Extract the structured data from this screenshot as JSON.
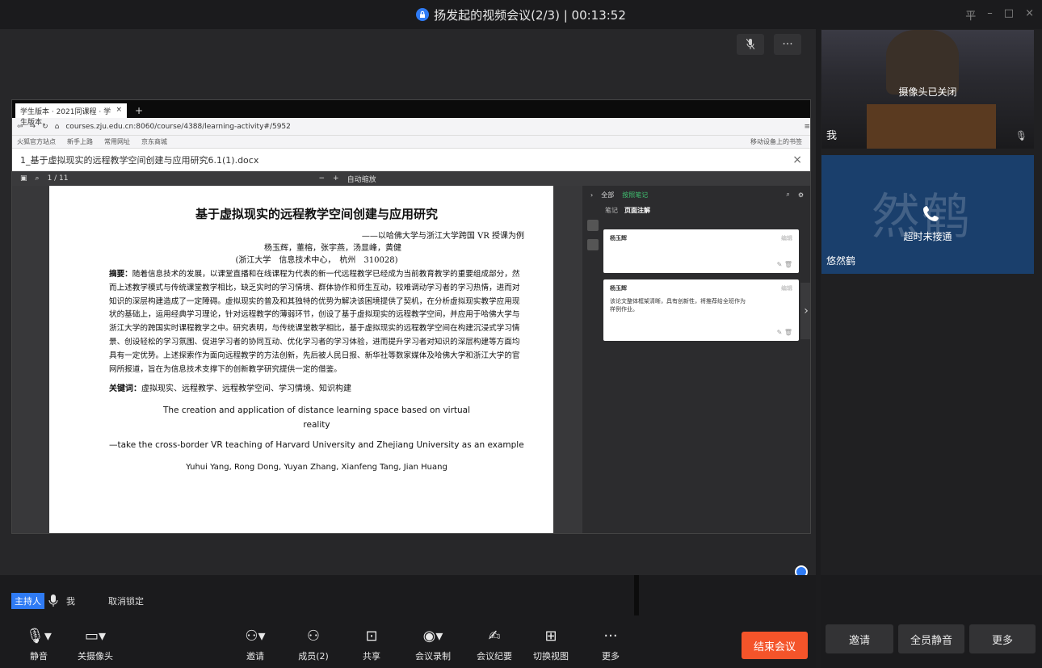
{
  "window": {
    "title": "扬发起的视频会议(2/3) | 00:13:52",
    "controls": [
      "平",
      "–",
      "□",
      "×"
    ]
  },
  "top_tools": {
    "mic_icon": "mic-icon",
    "more": "···"
  },
  "browser": {
    "tab_label": "学生版本 · 2021同课程 · 学生版本",
    "url": "courses.zju.edu.cn:8060/course/4388/learning-activity#/5952",
    "bookmarks": [
      "火狐官方站点",
      "新手上路",
      "常用网址",
      "京东商城"
    ],
    "bookmark_right": "移动设备上的书签"
  },
  "document": {
    "name": "1_基于虚拟现实的远程教学空间创建与应用研究6.1(1).docx",
    "page_indicator": "1 / 11",
    "zoom": "自动缩放"
  },
  "paper": {
    "title": "基于虚拟现实的远程教学空间创建与应用研究",
    "subtitle": "——以哈佛大学与浙江大学跨国 VR 授课为例",
    "authors": "杨玉辉，董榕，张宇燕，汤显峰，黄健",
    "affiliation": "(浙江大学　信息技术中心，　杭州　310028)",
    "abstract_label": "摘要：",
    "abstract": "随着信息技术的发展，以课堂直播和在线课程为代表的新一代远程教学已经成为当前教育教学的重要组成部分，然而上述教学模式与传统课堂教学相比，缺乏实时的学习情境、群体协作和师生互动，较难调动学习者的学习热情，进而对知识的深层构建造成了一定障碍。虚拟现实的普及和其独特的优势为解决该困境提供了契机，在分析虚拟现实教学应用现状的基础上，运用经典学习理论，针对远程教学的薄弱环节，创设了基于虚拟现实的远程教学空间，并应用于哈佛大学与浙江大学的跨国实时课程教学之中。研究表明，与传统课堂教学相比，基于虚拟现实的远程教学空间在构建沉浸式学习情景、创设轻松的学习氛围、促进学习者的协同互动、优化学习者的学习体验，进而提升学习者对知识的深层构建等方面均具有一定优势。上述探索作为面向远程教学的方法创新，先后被人民日报、新华社等数家媒体及哈佛大学和浙江大学的官网所报道，旨在为信息技术支撑下的创新教学研究提供一定的借鉴。",
    "keywords_label": "关键词：",
    "keywords": "虚拟现实、远程教学、远程教学空间、学习情境、知识构建",
    "en_title_1": "The creation and application of distance learning space based on virtual",
    "en_title_2": "reality",
    "en_subtitle": "—take the cross-border VR teaching of Harvard University and Zhejiang University as an example",
    "en_authors": "Yuhui Yang, Rong Dong, Yuyan Zhang, Xianfeng Tang, Jian Huang"
  },
  "notes": {
    "scope": "全部",
    "filter": "按照笔记",
    "tab_notes": "笔记",
    "tab_annot": "页面注解",
    "card1_name": "杨玉辉",
    "card1_time": "编辑",
    "card2_name": "杨玉辉",
    "card2_time": "编辑",
    "card2_text": "该论文整体框架清晰，具有创新性，将推荐给全班作为样例作业。"
  },
  "participants": [
    {
      "name": "我",
      "status": "摄像头已关闭"
    },
    {
      "name": "悠然鹤",
      "avatar_text": "然鹤",
      "status": "超时未接通"
    }
  ],
  "host_bar": {
    "role": "主持人",
    "me": "我",
    "unlock": "取消锁定"
  },
  "toolbar": {
    "mute": "静音",
    "camera": "关摄像头",
    "invite": "邀请",
    "members": "成员(2)",
    "share": "共享",
    "record": "会议录制",
    "minutes": "会议纪要",
    "switch_view": "切换视图",
    "more": "更多",
    "end": "结束会议"
  },
  "right_buttons": {
    "invite": "邀请",
    "mute_all": "全员静音",
    "more": "更多"
  },
  "colors": {
    "accent": "#2f7bf4",
    "end": "#f4542a",
    "avatar_bg": "#1a3f6c"
  }
}
